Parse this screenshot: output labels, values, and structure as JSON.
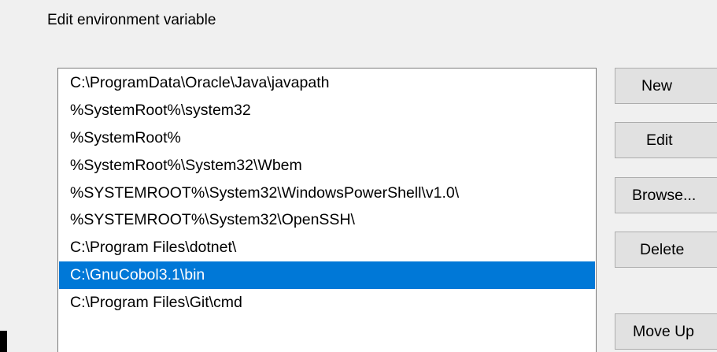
{
  "dialog": {
    "title": "Edit environment variable"
  },
  "paths": [
    {
      "value": "C:\\ProgramData\\Oracle\\Java\\javapath",
      "selected": false
    },
    {
      "value": "%SystemRoot%\\system32",
      "selected": false
    },
    {
      "value": "%SystemRoot%",
      "selected": false
    },
    {
      "value": "%SystemRoot%\\System32\\Wbem",
      "selected": false
    },
    {
      "value": "%SYSTEMROOT%\\System32\\WindowsPowerShell\\v1.0\\",
      "selected": false
    },
    {
      "value": "%SYSTEMROOT%\\System32\\OpenSSH\\",
      "selected": false
    },
    {
      "value": "C:\\Program Files\\dotnet\\",
      "selected": false
    },
    {
      "value": "C:\\GnuCobol3.1\\bin",
      "selected": true
    },
    {
      "value": "C:\\Program Files\\Git\\cmd",
      "selected": false
    },
    {
      "value": "",
      "selected": false
    }
  ],
  "buttons": {
    "new": "New",
    "edit": "Edit",
    "browse": "Browse...",
    "delete": "Delete",
    "move_up": "Move Up"
  },
  "colors": {
    "selection": "#0078d7",
    "selection_text": "#ffffff",
    "background": "#f0f0f0"
  }
}
